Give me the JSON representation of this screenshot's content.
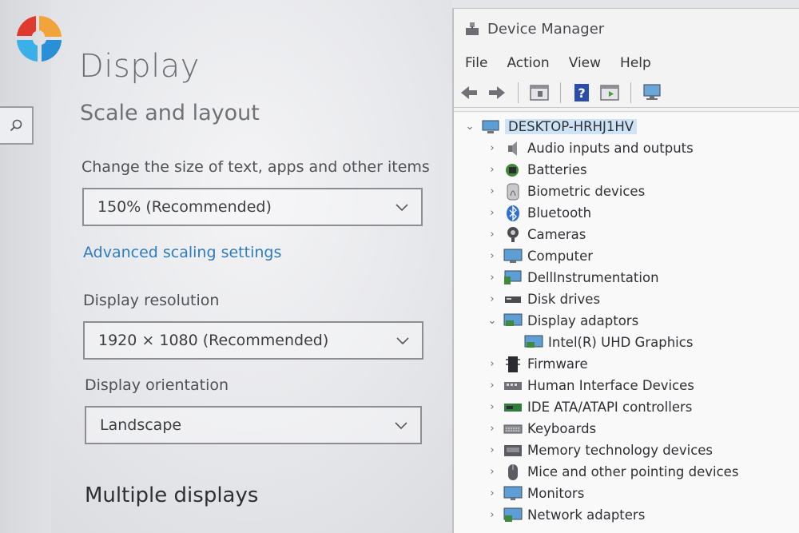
{
  "settings": {
    "page_title": "Display",
    "section_title": "Scale and layout",
    "scale_label": "Change the size of text, apps and other items",
    "scale_value": "150% (Recommended)",
    "advanced_link": "Advanced scaling settings",
    "resolution_label": "Display resolution",
    "resolution_value": "1920 × 1080 (Recommended)",
    "orientation_label": "Display orientation",
    "orientation_value": "Landscape",
    "multiple_displays": "Multiple displays"
  },
  "device_manager": {
    "title": "Device Manager",
    "menu": [
      "File",
      "Action",
      "View",
      "Help"
    ],
    "root": "DESKTOP-HRHJ1HV",
    "items": [
      {
        "label": "Audio inputs and outputs",
        "icon": "speaker-icon"
      },
      {
        "label": "Batteries",
        "icon": "battery-icon"
      },
      {
        "label": "Biometric devices",
        "icon": "fingerprint-icon"
      },
      {
        "label": "Bluetooth",
        "icon": "bluetooth-icon"
      },
      {
        "label": "Cameras",
        "icon": "camera-icon"
      },
      {
        "label": "Computer",
        "icon": "computer-icon"
      },
      {
        "label": "DellInstrumentation",
        "icon": "monitor-icon"
      },
      {
        "label": "Disk drives",
        "icon": "disk-icon"
      },
      {
        "label": "Display adaptors",
        "icon": "display-adapter-icon"
      },
      {
        "label": "Intel(R) UHD Graphics",
        "icon": "display-adapter-icon"
      },
      {
        "label": "Firmware",
        "icon": "chip-icon"
      },
      {
        "label": "Human Interface Devices",
        "icon": "hid-icon"
      },
      {
        "label": "IDE ATA/ATAPI controllers",
        "icon": "controller-icon"
      },
      {
        "label": "Keyboards",
        "icon": "keyboard-icon"
      },
      {
        "label": "Memory technology devices",
        "icon": "memory-icon"
      },
      {
        "label": "Mice and other pointing devices",
        "icon": "mouse-icon"
      },
      {
        "label": "Monitors",
        "icon": "monitor-icon"
      },
      {
        "label": "Network adapters",
        "icon": "network-icon"
      }
    ]
  },
  "colors": {
    "link": "#2d7cc2",
    "selection": "#cfe3f6"
  }
}
